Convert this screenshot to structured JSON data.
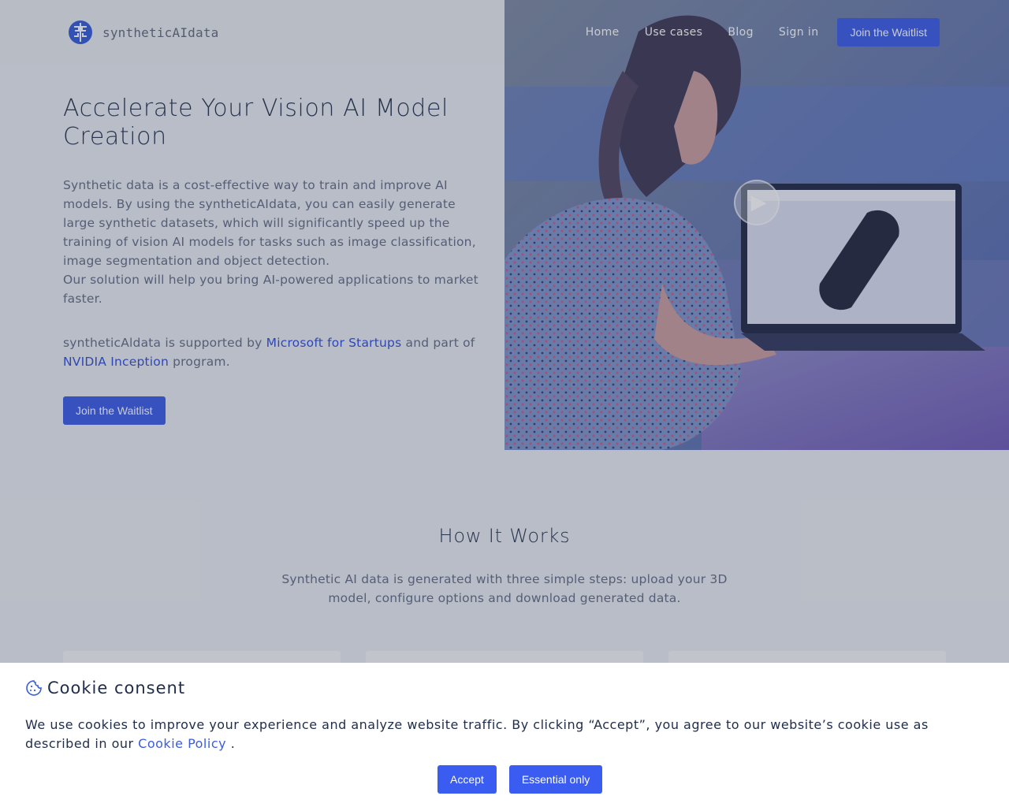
{
  "brand": {
    "name": "syntheticAIdata"
  },
  "nav": {
    "links": [
      "Home",
      "Use cases",
      "Blog",
      "Sign in"
    ],
    "cta": "Join the Waitlist"
  },
  "hero": {
    "title": "Accelerate Your Vision AI Model Creation",
    "description_lines": [
      "Synthetic data is a cost-effective way to train and improve AI models. By using the syntheticAIdata, you can easily generate large synthetic datasets, which will significantly speed up the training of vision AI models for tasks such as image classification, image segmentation and object detection.",
      "Our solution will help you bring AI-powered applications to market faster."
    ],
    "support": {
      "prefix": "syntheticAldata is supported by",
      "link1": "Microsoft for Startups",
      "middle": "and part of",
      "link2": "NVIDIA Inception",
      "suffix": "program."
    },
    "cta": "Join the Waitlist",
    "video": {
      "play_icon": "play-icon"
    }
  },
  "how_it_works": {
    "title": "How It Works",
    "text": "Synthetic AI data is generated with three simple steps: upload your 3D model, configure options and download generated data."
  },
  "cookie": {
    "icon": "cookie-icon",
    "title": "Cookie consent",
    "text_prefix": "We use cookies to improve your experience and analyze website traffic. By clicking “Accept”, you agree to our website’s cookie use as described in our",
    "policy_link": "Cookie Policy",
    "text_suffix": ".",
    "accept": "Accept",
    "essential": "Essential only"
  },
  "colors": {
    "primary": "#3557e6",
    "link": "#2a49d8",
    "heading": "#1f2d4a",
    "body_text": "#5f6982"
  }
}
